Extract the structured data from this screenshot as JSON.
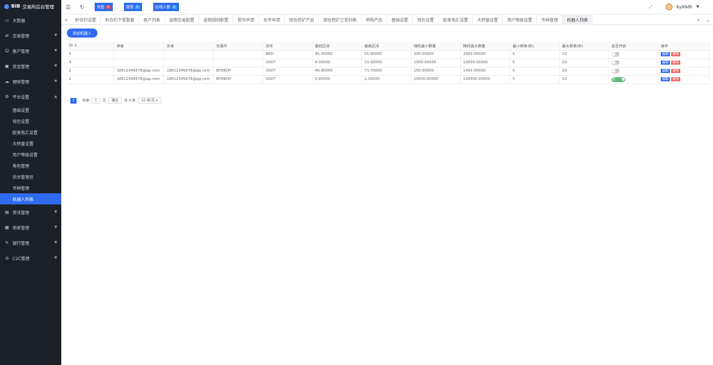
{
  "app": {
    "logo": "BiB",
    "title": "交易所后台管理"
  },
  "sidebar": {
    "items": [
      {
        "label": "大数据",
        "icon": "monitor-icon"
      },
      {
        "label": "交易管理",
        "icon": "exchange-icon"
      },
      {
        "label": "客户管理",
        "icon": "user-icon"
      },
      {
        "label": "资金管理",
        "icon": "wallet-icon"
      },
      {
        "label": "理财管理",
        "icon": "cloud-icon"
      },
      {
        "label": "平台设置",
        "icon": "gear-icon"
      }
    ],
    "sub_items": [
      "基础设置",
      "钱包设置",
      "欧美电汇设置",
      "大转盘设置",
      "用户等级设置",
      "角色管理",
      "后台管理员",
      "币种管理",
      "机器人列表"
    ],
    "bottom_items": [
      {
        "label": "资讯管理",
        "icon": "doc-icon"
      },
      {
        "label": "商家管理",
        "icon": "shop-icon"
      },
      {
        "label": "银行管理",
        "icon": "pen-icon"
      },
      {
        "label": "C2C管理",
        "icon": "c2c-icon"
      }
    ]
  },
  "topbar": {
    "charge": {
      "label": "充值",
      "count": "0"
    },
    "withdraw": {
      "label": "提现",
      "count": "0"
    },
    "online": {
      "label": "在线人数",
      "count": "0"
    },
    "username": "by99dh"
  },
  "tabs": [
    "秒合约设置",
    "秒合约下单数量",
    "客户列表",
    "返佣交易配置",
    "返佣规则配置",
    "提币申请",
    "充币申请",
    "锁仓挖矿产品",
    "锁仓挖矿订单列表",
    "申购产品",
    "基础设置",
    "钱包设置",
    "欧美电汇设置",
    "大转盘设置",
    "用户等级设置",
    "币种管理",
    "机器人列表"
  ],
  "active_tab": "机器人列表",
  "add_button": "添加机器人",
  "table": {
    "headers": [
      "ID ⇕",
      "卖家",
      "买家",
      "交易币",
      "法币",
      "最低区间",
      "最高区间",
      "随机最小数量",
      "随机最大数量",
      "最小频率(秒)",
      "最大频率(秒)",
      "是否开启",
      "操作"
    ],
    "rows": [
      {
        "id": "5",
        "seller": "",
        "buyer": "",
        "coin": "",
        "fiat": "NEO",
        "low": "45.00000",
        "high": "55.00000",
        "min_qty": "200.00000",
        "max_qty": "2000.00000",
        "min_freq": "5",
        "max_freq": "10",
        "enabled": false
      },
      {
        "id": "4",
        "seller": "",
        "buyer": "",
        "coin": "",
        "fiat": "USDT",
        "low": "9.00000",
        "high": "13.00000",
        "min_qty": "1000.00000",
        "max_qty": "10000.00000",
        "min_freq": "5",
        "max_freq": "10",
        "enabled": false
      },
      {
        "id": "2",
        "seller": "18812345678@qq.com",
        "buyer": "18812345678@qq.com",
        "coin": "BY99DH",
        "fiat": "USDT",
        "low": "46.90000",
        "high": "73.70000",
        "min_qty": "150.00000",
        "max_qty": "1493.00000",
        "min_freq": "5",
        "max_freq": "10",
        "enabled": false
      },
      {
        "id": "1",
        "seller": "18812345678@qq.com",
        "buyer": "18812345678@qq.com",
        "coin": "BY99DH",
        "fiat": "USDT",
        "low": "0.90000",
        "high": "1.30000",
        "min_qty": "10000.00000",
        "max_qty": "100000.00000",
        "min_freq": "5",
        "max_freq": "10",
        "enabled": true
      }
    ],
    "toggle_off": "否",
    "toggle_on": "是",
    "edit": "编辑",
    "delete": "删除"
  },
  "pager": {
    "current": "1",
    "goto": "到第",
    "page_value": "1",
    "page_unit": "页",
    "confirm": "确定",
    "total": "共 4 条",
    "per_page": "10 条/页"
  }
}
